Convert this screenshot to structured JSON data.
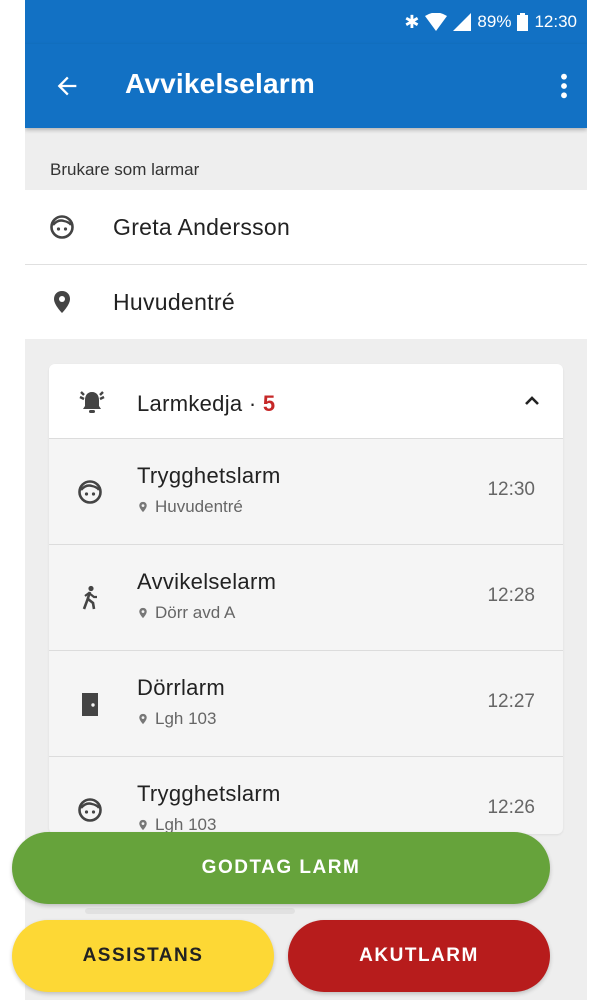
{
  "colors": {
    "primary": "#1271c4",
    "accept": "#66a33b",
    "assist": "#fdd835",
    "akut": "#b71c1c",
    "count_red": "#c62828"
  },
  "status_bar": {
    "battery": "89%",
    "time": "12:30",
    "icons": [
      "bluetooth-icon",
      "wifi-icon",
      "signal-icon",
      "battery-icon"
    ]
  },
  "app_bar": {
    "title": "Avvikelselarm",
    "back_icon": "arrow-back-icon",
    "menu_icon": "more-vert-icon"
  },
  "resident": {
    "section_label": "Brukare som larmar",
    "name": "Greta Andersson",
    "name_icon": "face-icon",
    "location": "Huvudentré",
    "location_icon": "location-pin-icon"
  },
  "alarm_chain": {
    "label": "Larmkedja · ",
    "count": "5",
    "icon": "bell-ringing-icon",
    "collapse_icon": "chevron-up-icon",
    "items": [
      {
        "type": "Trygghetslarm",
        "location": "Huvudentré",
        "time": "12:30",
        "icon": "face-icon"
      },
      {
        "type": "Avvikelselarm",
        "location": "Dörr avd A",
        "time": "12:28",
        "icon": "walking-person-icon"
      },
      {
        "type": "Dörrlarm",
        "location": "Lgh 103",
        "time": "12:27",
        "icon": "door-icon"
      },
      {
        "type": "Trygghetslarm",
        "location": "Lgh 103",
        "time": "12:26",
        "icon": "face-icon"
      }
    ]
  },
  "actions": {
    "accept": "GODTAG LARM",
    "assist": "ASSISTANS",
    "emergency": "AKUTLARM"
  }
}
